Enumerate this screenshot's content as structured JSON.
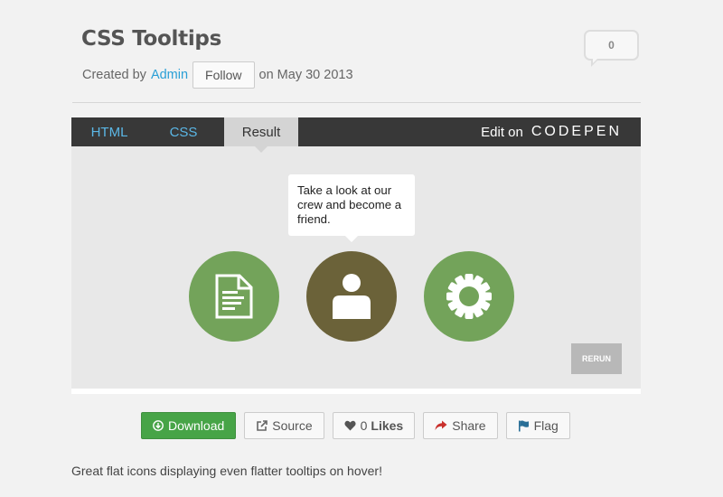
{
  "header": {
    "title": "CSS Tooltips",
    "created_by_prefix": "Created by",
    "author": "Admin",
    "follow_label": "Follow",
    "date_text": "on May 30 2013",
    "comment_count": "0"
  },
  "embed": {
    "tabs": [
      "HTML",
      "CSS",
      "Result"
    ],
    "active_tab": "Result",
    "edit_on_label": "Edit on",
    "brand": "CODEPEN",
    "tooltip_text": "Take a look at our crew and become a friend.",
    "rerun_label": "RERUN",
    "icons": [
      "document-icon",
      "user-icon",
      "gear-icon"
    ],
    "colors": {
      "green": "#73a35a",
      "olive": "#6b6239",
      "tab_bar": "#383838",
      "tab_link": "#5bb7e6"
    }
  },
  "actions": {
    "download_label": "Download",
    "source_label": "Source",
    "likes_count": "0",
    "likes_label": "Likes",
    "share_label": "Share",
    "flag_label": "Flag"
  },
  "description": "Great flat icons displaying even flatter tooltips on hover!"
}
